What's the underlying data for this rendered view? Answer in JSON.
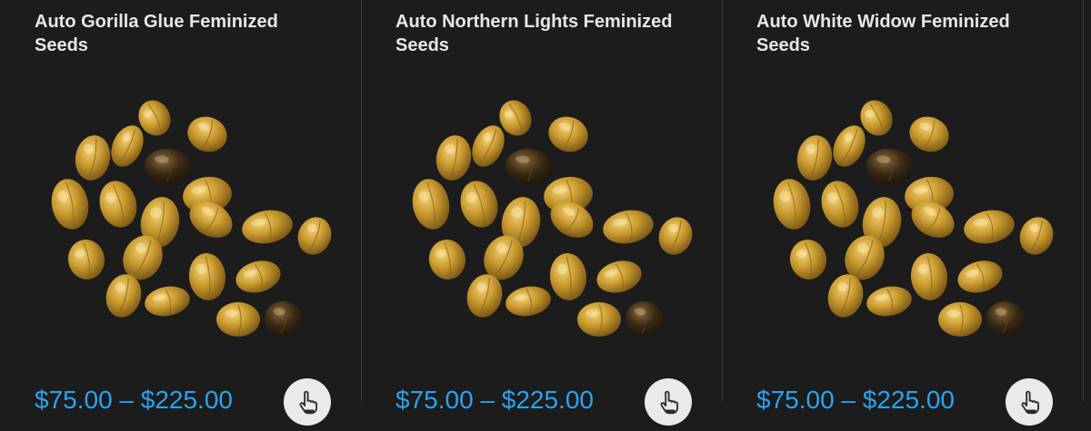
{
  "products": [
    {
      "title": "Auto Gorilla Glue Feminized Seeds",
      "price": "$75.00 – $225.00",
      "image_icon": "cannabis-seeds-image",
      "action_icon": "hand-pointer-icon"
    },
    {
      "title": "Auto Northern Lights Feminized Seeds",
      "price": "$75.00 – $225.00",
      "image_icon": "cannabis-seeds-image",
      "action_icon": "hand-pointer-icon"
    },
    {
      "title": "Auto White Widow Feminized Seeds",
      "price": "$75.00 – $225.00",
      "image_icon": "cannabis-seeds-image",
      "action_icon": "hand-pointer-icon"
    }
  ],
  "colors": {
    "background": "#1c1c1c",
    "title": "#e7e7e7",
    "price": "#2aa3f0",
    "button": "#e9eaec",
    "seed_gold": "#c99a2e",
    "seed_dark": "#3a2a14"
  }
}
